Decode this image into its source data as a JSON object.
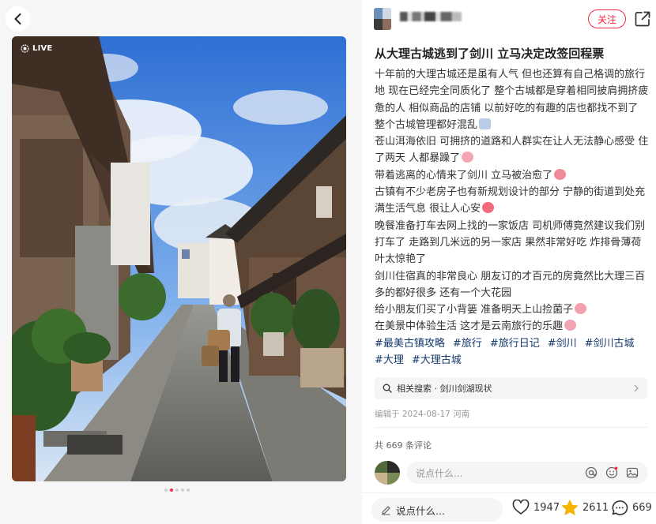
{
  "nav": {
    "back_icon": "chevron-left-icon"
  },
  "media": {
    "live_label": "LIVE",
    "slides_total": 5,
    "slide_current": 2
  },
  "author": {
    "name": "",
    "follow_label": "关注",
    "share_icon": "share-icon"
  },
  "post": {
    "title": "从大理古城逃到了剑川 立马决定改签回程票",
    "paragraphs": [
      "十年前的大理古城还是虽有人气 但也还算有自己格调的旅行地 现在已经完全同质化了 整个古城都是穿着相同披肩拥挤疲惫的人 相似商品的店铺 以前好吃的有趣的店也都找不到了 整个古城管理都好混乱",
      "苍山洱海依旧 可拥挤的道路和人群实在让人无法静心感受 住了两天 人都暴躁了",
      "带着逃离的心情来了剑川 立马被治愈了",
      "古镇有不少老房子也有新规划设计的部分 宁静的街道到处充满生活气息 很让人心安",
      "晚餐准备打车去网上找的一家饭店 司机师傅竟然建议我们别打车了 走路到几米远的另一家店 果然非常好吃 炸排骨薄荷叶太惊艳了",
      "剑川住宿真的非常良心 朋友订的才百元的房竟然比大理三百多的都好很多 还有一个大花园",
      "给小朋友们买了小背篓 准备明天上山捡菌子",
      "在美景中体验生活 这才是云南旅行的乐趣"
    ],
    "tags": [
      "#最美古镇攻略",
      "#旅行",
      "#旅行日记",
      "#剑川",
      "#剑川古城",
      "#大理",
      "#大理古城"
    ],
    "related_search": "相关搜索 · 剑川剑湖现状",
    "edited": "编辑于 2024-08-17 河南"
  },
  "comments": {
    "count_label": "共 669 条评论",
    "input_placeholder": "说点什么..."
  },
  "bottom": {
    "say_label": "说点什么...",
    "likes": "1947",
    "favorites": "2611",
    "comments": "669"
  },
  "colors": {
    "accent": "#ff2442",
    "tag": "#13386c",
    "star": "#f5b400"
  }
}
